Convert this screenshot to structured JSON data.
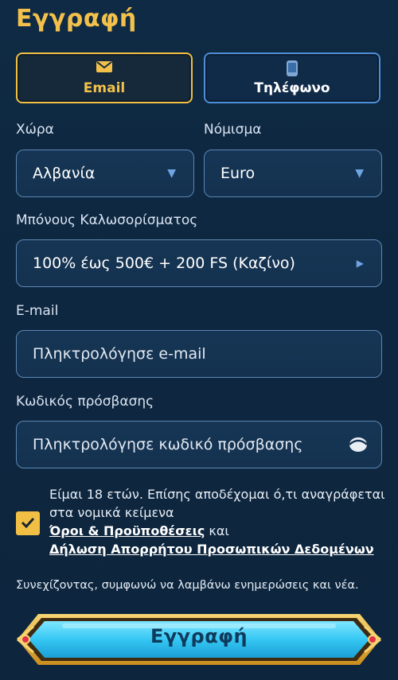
{
  "page": {
    "title": "Εγγραφή"
  },
  "tabs": [
    {
      "label": "Email",
      "icon": "envelope-icon",
      "active": true
    },
    {
      "label": "Τηλέφωνο",
      "icon": "phone-icon",
      "active": false
    }
  ],
  "form": {
    "country": {
      "label": "Χώρα",
      "value": "Αλβανία"
    },
    "currency": {
      "label": "Νόμισμα",
      "value": "Euro"
    },
    "bonus": {
      "label": "Μπόνους Καλωσορίσματος",
      "value": "100% έως 500€ + 200 FS (Καζίνο)"
    },
    "email": {
      "label": "E-mail",
      "placeholder": "Πληκτρολόγησε e-mail"
    },
    "password": {
      "label": "Κωδικός πρόσβασης",
      "placeholder": "Πληκτρολόγησε κωδικό πρόσβασης"
    }
  },
  "consent": {
    "checked": true,
    "text": "Είμαι 18 ετών. Επίσης αποδέχομαι ό,τι αναγράφεται στα νομικά κείμενα",
    "terms_link": "Όροι & Προϋποθέσεις",
    "and": "και",
    "privacy_link": "Δήλωση Απορρήτου Προσωπικών Δεδομένων"
  },
  "notice": "Συνεχίζοντας, συμφωνώ να λαμβάνω ενημερώσεις και νέα.",
  "submit": {
    "label": "Εγγραφή"
  },
  "colors": {
    "accent": "#f1bf43",
    "background": "#0f2a44",
    "field_border": "#5c86b3",
    "button": "#35c7f3"
  }
}
